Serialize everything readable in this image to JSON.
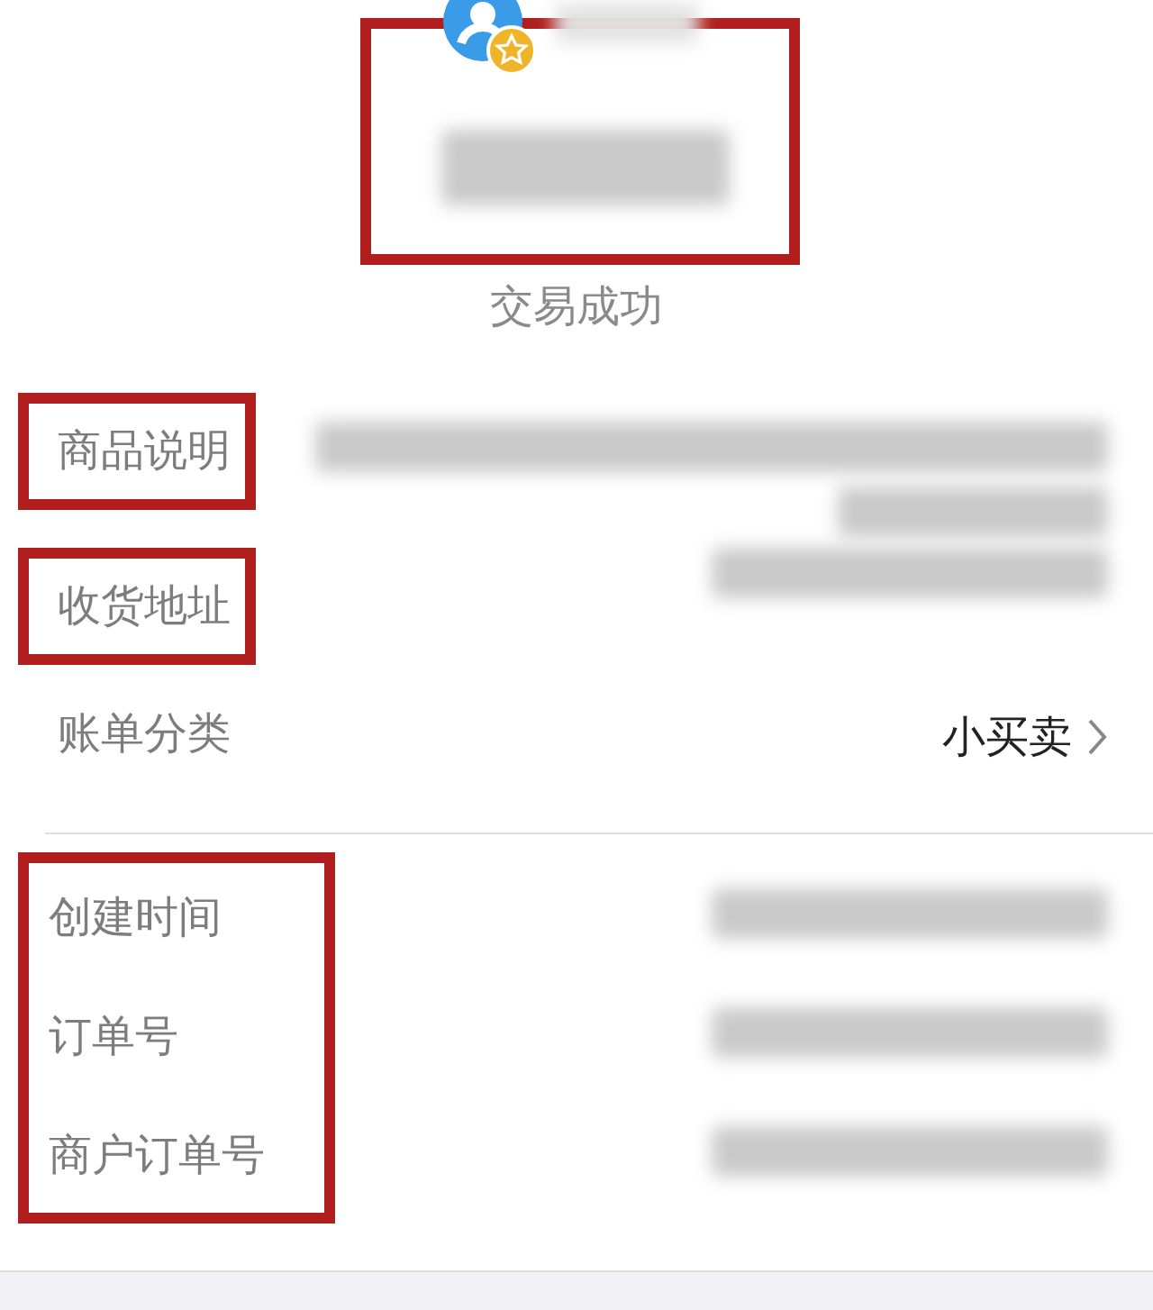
{
  "header": {
    "annotated": true,
    "name_blurred": true,
    "amount_blurred": true
  },
  "status": "交易成功",
  "sections": [
    {
      "rows": [
        {
          "label": "商品说明",
          "annotated": true,
          "kind": "redacted_2"
        },
        {
          "label": "收货地址",
          "annotated": true,
          "kind": "redacted"
        },
        {
          "label": "账单分类",
          "kind": "link",
          "value": "小买卖"
        }
      ]
    },
    {
      "label_frame": true,
      "rows": [
        {
          "label": "创建时间",
          "kind": "redacted"
        },
        {
          "label": "订单号",
          "kind": "redacted"
        },
        {
          "label": "商户订单号",
          "kind": "redacted"
        }
      ]
    }
  ]
}
